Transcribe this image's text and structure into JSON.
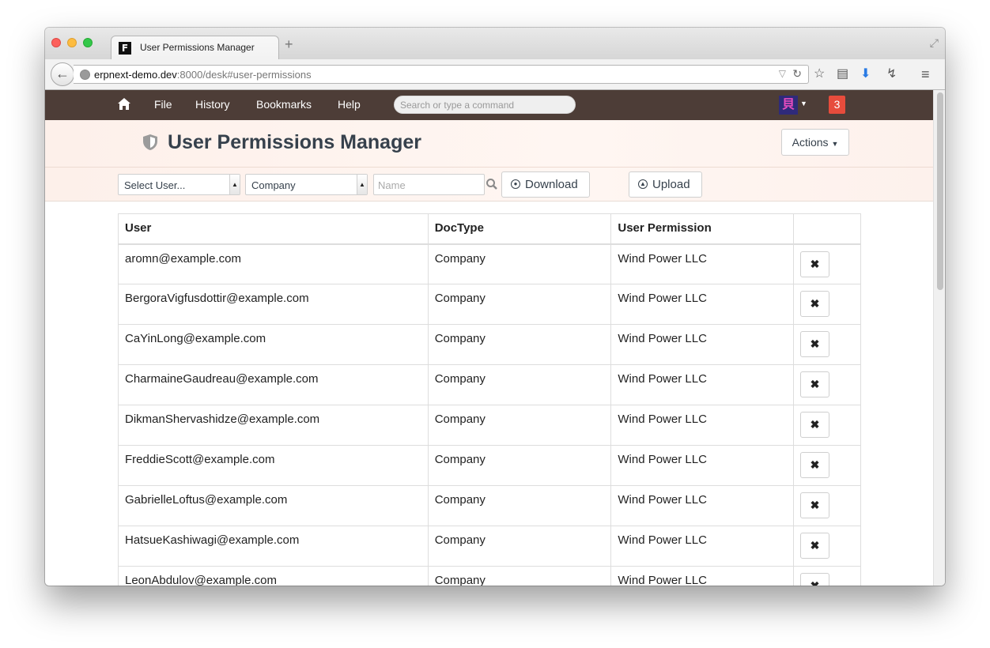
{
  "browser": {
    "tab_title": "User Permissions Manager",
    "url_main": "erpnext-demo.dev",
    "url_rest": ":8000/desk#user-permissions",
    "favicon_letter": "F",
    "new_tab_symbol": "+"
  },
  "navbar": {
    "links": [
      "File",
      "History",
      "Bookmarks",
      "Help"
    ],
    "search_placeholder": "Search or type a command",
    "notification_count": "3",
    "avatar_glyph": "貝"
  },
  "page": {
    "title": "User Permissions Manager",
    "actions_label": "Actions"
  },
  "filters": {
    "user_select": "Select User...",
    "doctype_select": "Company",
    "name_placeholder": "Name",
    "download_label": "Download",
    "upload_label": "Upload"
  },
  "table": {
    "headers": [
      "User",
      "DocType",
      "User Permission"
    ],
    "rows": [
      {
        "user": "aromn@example.com",
        "doctype": "Company",
        "permission": "Wind Power LLC"
      },
      {
        "user": "BergoraVigfusdottir@example.com",
        "doctype": "Company",
        "permission": "Wind Power LLC"
      },
      {
        "user": "CaYinLong@example.com",
        "doctype": "Company",
        "permission": "Wind Power LLC"
      },
      {
        "user": "CharmaineGaudreau@example.com",
        "doctype": "Company",
        "permission": "Wind Power LLC"
      },
      {
        "user": "DikmanShervashidze@example.com",
        "doctype": "Company",
        "permission": "Wind Power LLC"
      },
      {
        "user": "FreddieScott@example.com",
        "doctype": "Company",
        "permission": "Wind Power LLC"
      },
      {
        "user": "GabrielleLoftus@example.com",
        "doctype": "Company",
        "permission": "Wind Power LLC"
      },
      {
        "user": "HatsueKashiwagi@example.com",
        "doctype": "Company",
        "permission": "Wind Power LLC"
      },
      {
        "user": "LeonAbdulov@example.com",
        "doctype": "Company",
        "permission": "Wind Power LLC"
      }
    ]
  },
  "colors": {
    "navbar": "#4d3d37",
    "notification": "#e74c3c",
    "page_head": "#fdf0ea"
  }
}
